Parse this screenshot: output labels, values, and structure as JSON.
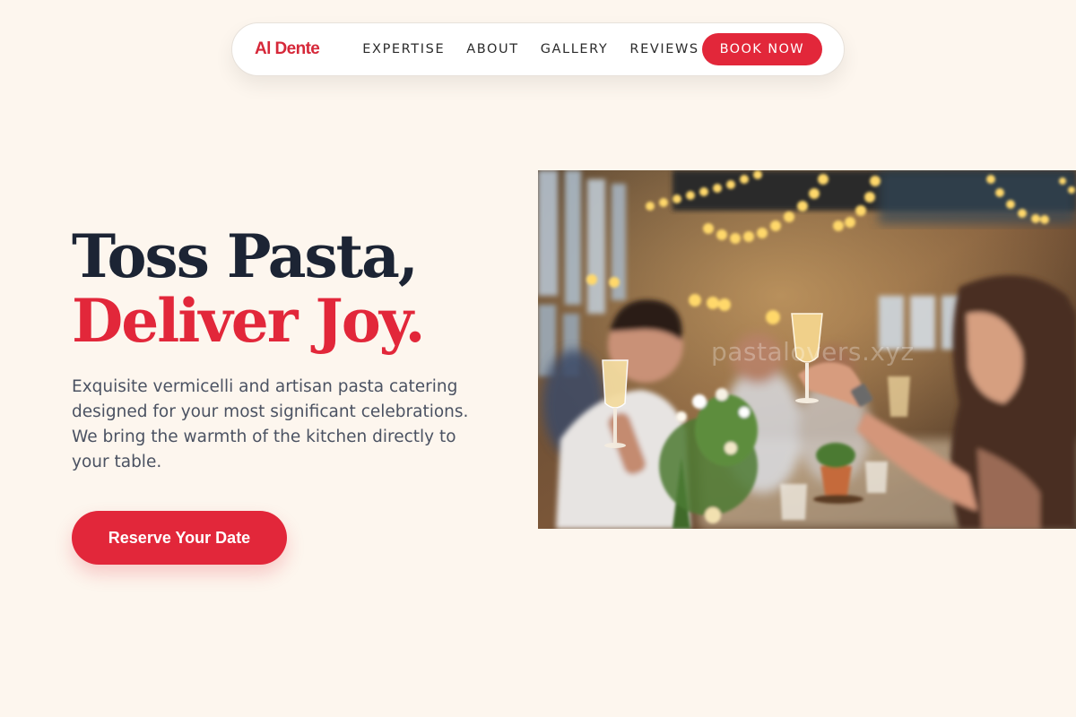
{
  "nav": {
    "brand": "Al Dente",
    "links": [
      "EXPERTISE",
      "ABOUT",
      "GALLERY",
      "REVIEWS"
    ],
    "cta": "BOOK NOW"
  },
  "hero": {
    "title_line1": "Toss Pasta,",
    "title_line2": "Deliver Joy.",
    "description": "Exquisite vermicelli and artisan pasta catering designed for your most significant celebrations. We bring the warmth of the kitchen directly to your table.",
    "cta": "Reserve Your Date",
    "image_watermark": "pastalovers.xyz"
  },
  "colors": {
    "page_background": "#fdf6ee",
    "accent": "#e2273a",
    "heading": "#1c2434",
    "body_text": "#4b5262"
  }
}
